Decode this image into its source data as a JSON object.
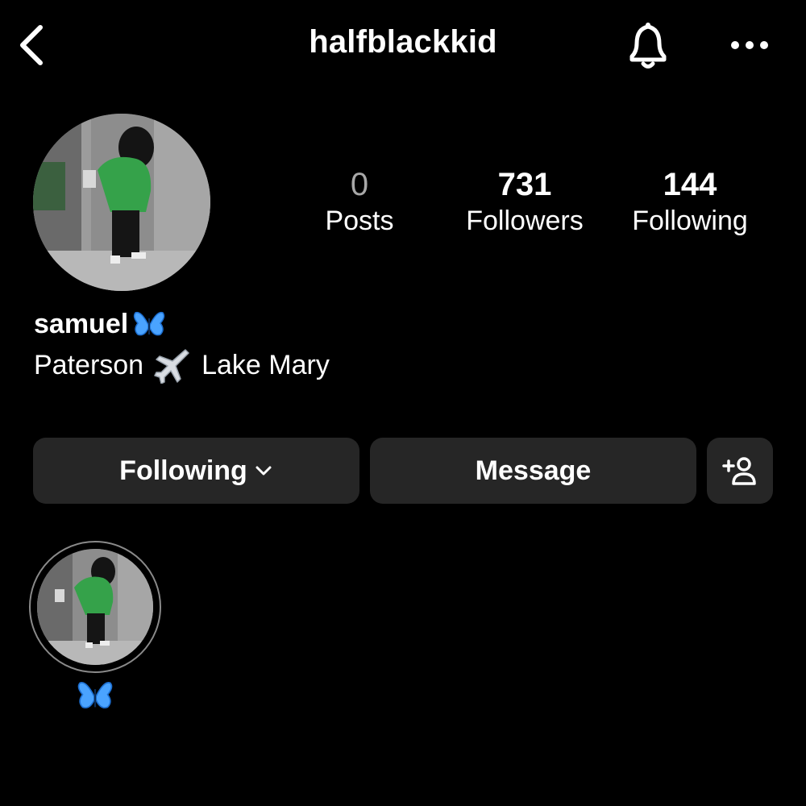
{
  "header": {
    "username": "halfblackkid",
    "back_icon": "chevron-left-icon",
    "bell_icon": "bell-icon",
    "more_icon": "more-horizontal-icon"
  },
  "profile": {
    "avatar_icon": "profile-photo",
    "stats": {
      "posts": {
        "count": "0",
        "label": "Posts"
      },
      "followers": {
        "count": "731",
        "label": "Followers"
      },
      "following": {
        "count": "144",
        "label": "Following"
      }
    },
    "display_name": "samuel",
    "bio_from": "Paterson",
    "bio_to": "Lake Mary",
    "bio_icon": "airplane-icon",
    "name_icon": "butterfly-icon"
  },
  "actions": {
    "following_label": "Following",
    "message_label": "Message",
    "add_user_icon": "add-user-icon"
  },
  "highlights": [
    {
      "label_icon": "butterfly-icon"
    }
  ],
  "colors": {
    "background": "#000000",
    "button_bg": "#262626",
    "butterfly_blue": "#4aa3ff"
  }
}
